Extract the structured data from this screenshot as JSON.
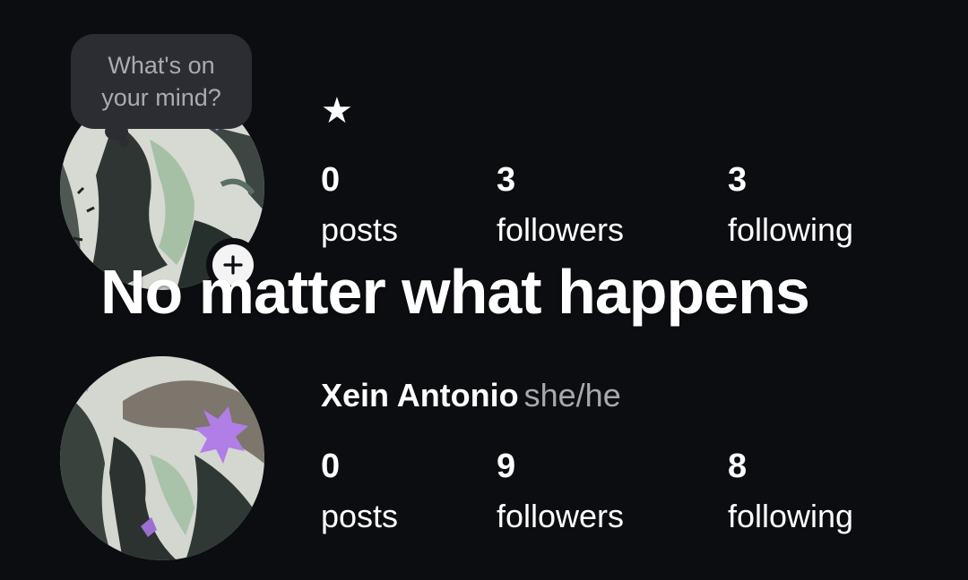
{
  "note": {
    "text": "What's on your mind?"
  },
  "profile_top": {
    "name": "★",
    "stats": {
      "posts": {
        "value": "0",
        "label": "posts"
      },
      "followers": {
        "value": "3",
        "label": "followers"
      },
      "following": {
        "value": "3",
        "label": "following"
      }
    }
  },
  "caption": "No matter what happens",
  "profile_bottom": {
    "name": "Xein Antonio",
    "pronouns": "she/he",
    "stats": {
      "posts": {
        "value": "0",
        "label": "posts"
      },
      "followers": {
        "value": "9",
        "label": "followers"
      },
      "following": {
        "value": "8",
        "label": "following"
      }
    }
  },
  "icons": {
    "add": "plus-icon",
    "star": "star-icon"
  },
  "colors": {
    "background": "#0c0d11",
    "bubble": "#2b2d33",
    "muted_text": "#a7a9ae",
    "accent_purple": "#b07ee6"
  }
}
